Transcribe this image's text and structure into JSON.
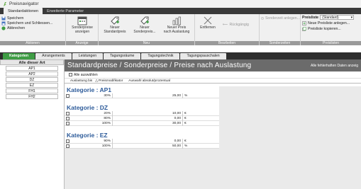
{
  "window": {
    "title": "Preisnavigator"
  },
  "ribbon_tabs": [
    "Standardaktionen",
    "Erweiterte Parameter"
  ],
  "ribbon": {
    "aktionen": {
      "save": "Speichern",
      "save_close": "Speichern und Schliessen...",
      "cancel": "Abbrechen",
      "label": "Aktionen"
    },
    "anzeige": {
      "show_line1": "Sonderpreise",
      "show_line2": "anzeigen",
      "label": "Anzeige"
    },
    "neu": {
      "std_line1": "Neuer",
      "std_line2": "Standardpreis",
      "sonder_line1": "Neuer",
      "sonder_line2": "Sonderpreis...",
      "auslast_line1": "Neuer Preis",
      "auslast_line2": "nach Auslastung",
      "label": "Neu"
    },
    "bearbeiten": {
      "remove": "Entfernen",
      "undo": "Rückgängig",
      "label": "Bearbeiten"
    },
    "sonderzeiten": {
      "add": "Sonderzeit anlegen...",
      "label": "Sonderzeiten"
    },
    "preislisten": {
      "field_label": "Preisliste",
      "selected": "(Standard)",
      "new": "Neue Preisliste anlegen...",
      "copy": "Preisliste kopieren...",
      "label": "Preislisten"
    }
  },
  "section_tabs": [
    "Kategorien",
    "Arrangements",
    "Leistungen",
    "Tagungsräume",
    "Tagungstechnik",
    "Tagungspauschalen"
  ],
  "leftnav": {
    "header": "Alle dieser Art",
    "items": [
      "AP1",
      "AP2",
      "DZ",
      "EZ",
      "FH1",
      "FH2"
    ]
  },
  "main": {
    "title": "Standardpreise / Sonderpreise / Preise nach Auslastung",
    "right_info": "Alle fehlerhaften Daten anzeig",
    "select_all": "Alle auswählen",
    "columns": [
      "Auslastung bis",
      "Preismodifikator",
      "Auswahl absolut/prozentual"
    ]
  },
  "categories": [
    {
      "title": "Kategorie : AP1",
      "rows": [
        {
          "pct": "30%",
          "val": "25,00",
          "unit": "%"
        }
      ]
    },
    {
      "title": "Kategorie : DZ",
      "rows": [
        {
          "pct": "20%",
          "val": "10,00",
          "unit": "€"
        },
        {
          "pct": "80%",
          "val": "0,00",
          "unit": "€"
        },
        {
          "pct": "100%",
          "val": "30,00",
          "unit": "€"
        }
      ]
    },
    {
      "title": "Kategorie : EZ",
      "rows": [
        {
          "pct": "90%",
          "val": "0,00",
          "unit": "€"
        },
        {
          "pct": "100%",
          "val": "50,00",
          "unit": "%"
        }
      ]
    }
  ]
}
